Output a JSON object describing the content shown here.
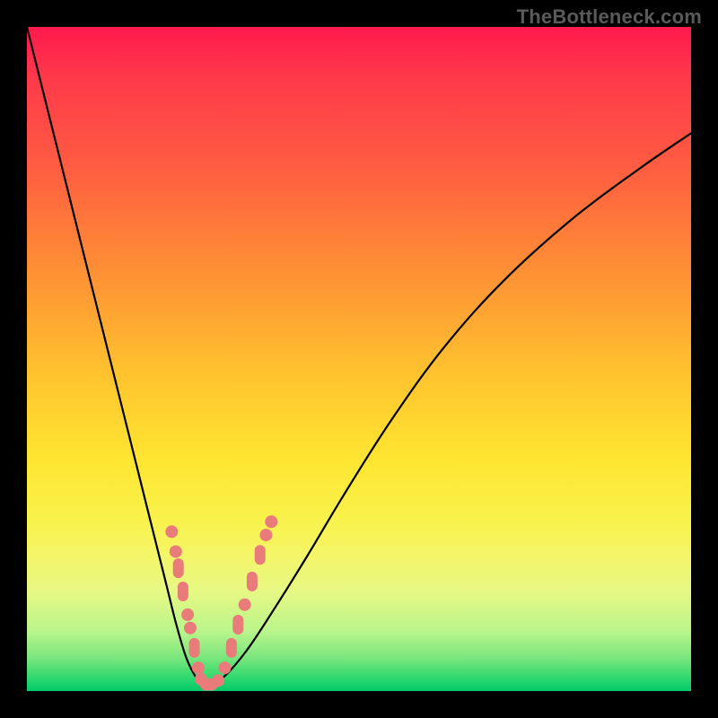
{
  "watermark": "TheBottleneck.com",
  "colors": {
    "frame": "#000000",
    "marker": "#e97b7a",
    "curve": "#000000",
    "gradient_top": "#ff1a4d",
    "gradient_bottom": "#00c96a"
  },
  "chart_data": {
    "type": "line",
    "title": "",
    "xlabel": "",
    "ylabel": "",
    "xlim": [
      0,
      100
    ],
    "ylim": [
      0,
      100
    ],
    "x": [
      0,
      5,
      10,
      14,
      17,
      19,
      21,
      22.5,
      24,
      25.5,
      27,
      29.5,
      33,
      37,
      42,
      48,
      55,
      63,
      72,
      82,
      92,
      100
    ],
    "values": [
      100,
      80,
      60,
      44,
      32,
      24,
      16,
      10,
      5,
      2,
      0.5,
      2,
      6,
      12,
      20,
      30,
      41,
      52,
      62,
      71,
      78.5,
      84
    ],
    "notch_x": 26.5,
    "marker_points_left": [
      {
        "x_rel": 21.8,
        "y_rel": 24.0,
        "shape": "round"
      },
      {
        "x_rel": 22.4,
        "y_rel": 21.0,
        "shape": "round"
      },
      {
        "x_rel": 22.8,
        "y_rel": 18.5,
        "shape": "pill"
      },
      {
        "x_rel": 23.5,
        "y_rel": 15.0,
        "shape": "pill"
      },
      {
        "x_rel": 24.2,
        "y_rel": 11.5,
        "shape": "round"
      },
      {
        "x_rel": 24.6,
        "y_rel": 9.5,
        "shape": "round"
      },
      {
        "x_rel": 25.2,
        "y_rel": 6.5,
        "shape": "pill"
      },
      {
        "x_rel": 25.8,
        "y_rel": 3.5,
        "shape": "round"
      }
    ],
    "marker_points_bottom": [
      {
        "x_rel": 26.2,
        "y_rel": 1.8,
        "shape": "round"
      },
      {
        "x_rel": 27.0,
        "y_rel": 1.0,
        "shape": "round"
      },
      {
        "x_rel": 27.8,
        "y_rel": 1.0,
        "shape": "round"
      },
      {
        "x_rel": 28.8,
        "y_rel": 1.6,
        "shape": "round"
      }
    ],
    "marker_points_right": [
      {
        "x_rel": 29.8,
        "y_rel": 3.5,
        "shape": "round"
      },
      {
        "x_rel": 30.8,
        "y_rel": 6.5,
        "shape": "pill"
      },
      {
        "x_rel": 31.8,
        "y_rel": 10.0,
        "shape": "pill"
      },
      {
        "x_rel": 32.8,
        "y_rel": 13.0,
        "shape": "round"
      },
      {
        "x_rel": 33.9,
        "y_rel": 16.5,
        "shape": "pill"
      },
      {
        "x_rel": 35.1,
        "y_rel": 20.5,
        "shape": "pill"
      },
      {
        "x_rel": 36.0,
        "y_rel": 23.5,
        "shape": "round"
      },
      {
        "x_rel": 36.8,
        "y_rel": 25.5,
        "shape": "round"
      }
    ]
  }
}
